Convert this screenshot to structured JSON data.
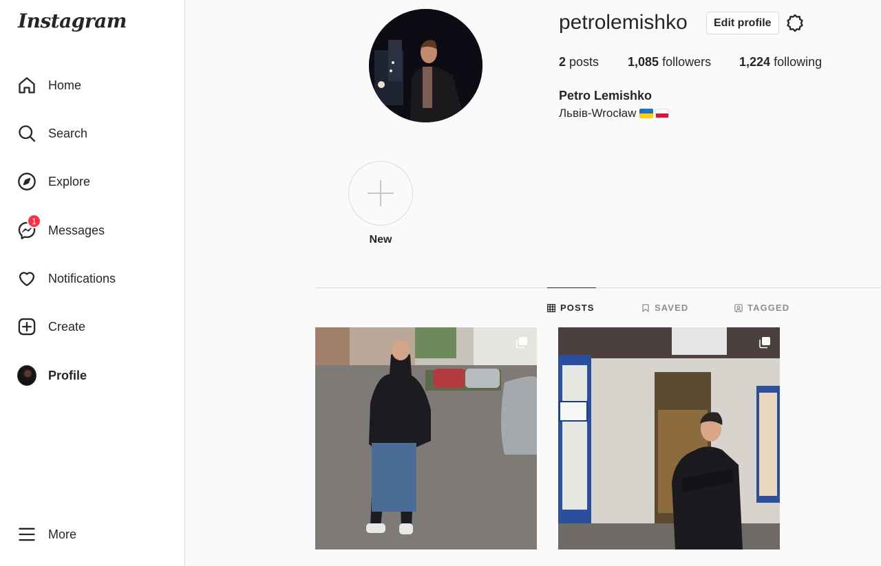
{
  "sidebar": {
    "logo": "Instagram",
    "items": [
      {
        "label": "Home",
        "icon": "home-icon"
      },
      {
        "label": "Search",
        "icon": "search-icon"
      },
      {
        "label": "Explore",
        "icon": "compass-icon"
      },
      {
        "label": "Messages",
        "icon": "messenger-icon",
        "badge": "1"
      },
      {
        "label": "Notifications",
        "icon": "heart-icon"
      },
      {
        "label": "Create",
        "icon": "plus-square-icon"
      },
      {
        "label": "Profile",
        "icon": "avatar"
      }
    ],
    "more_label": "More"
  },
  "profile": {
    "username": "petrolemishko",
    "edit_label": "Edit profile",
    "posts_count": "2",
    "posts_label": "posts",
    "followers_count": "1,085",
    "followers_label": "followers",
    "following_count": "1,224",
    "following_label": "following",
    "full_name": "Petro Lemishko",
    "bio": "Львів-Wrocław"
  },
  "highlights": {
    "new_label": "New"
  },
  "tabs": [
    {
      "label": "POSTS",
      "icon": "grid-icon",
      "active": true
    },
    {
      "label": "SAVED",
      "icon": "bookmark-icon",
      "active": false
    },
    {
      "label": "TAGGED",
      "icon": "tagged-icon",
      "active": false
    }
  ],
  "posts": [
    {
      "icon": "carousel-icon"
    },
    {
      "icon": "carousel-icon"
    }
  ],
  "colors": {
    "badge": "#ff3040",
    "border": "#dbdbdb",
    "text": "#262626",
    "muted": "#8e8e8e"
  }
}
